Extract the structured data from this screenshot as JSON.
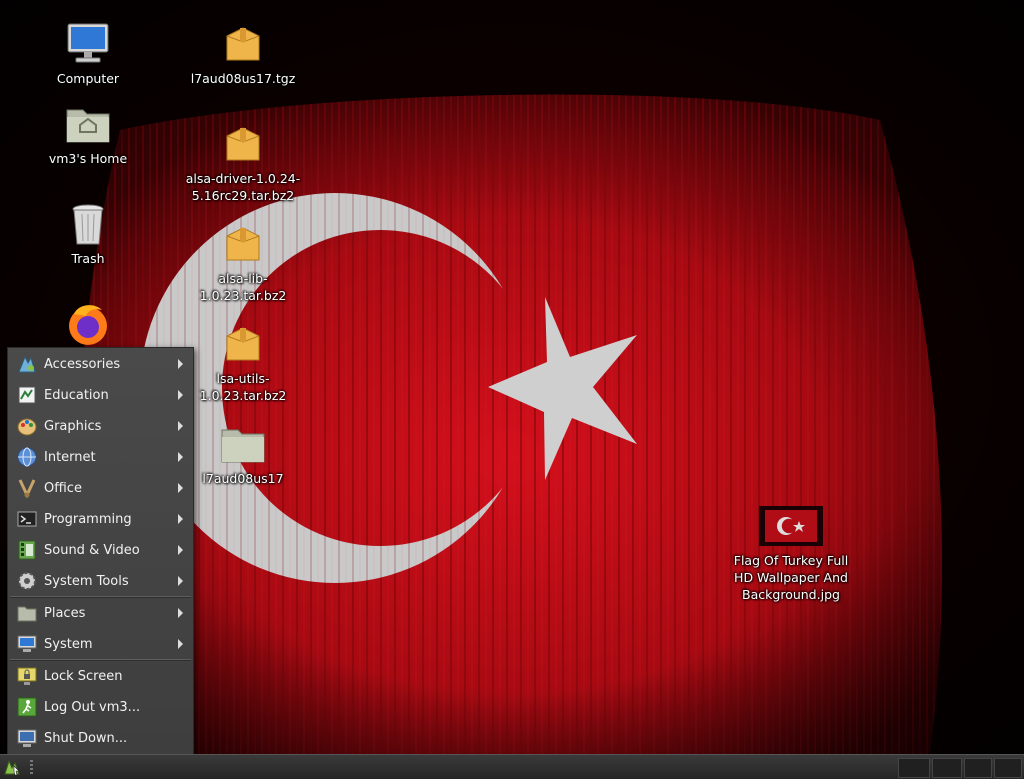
{
  "desktop": {
    "icons": [
      {
        "label": "Computer",
        "icon": "computer-icon"
      },
      {
        "label": "vm3's Home",
        "icon": "home-folder-icon"
      },
      {
        "label": "Trash",
        "icon": "trash-icon"
      },
      {
        "label": "",
        "icon": "firefox-icon"
      },
      {
        "label": "l7aud08us17.tgz",
        "icon": "archive-icon"
      },
      {
        "label": "alsa-driver-1.0.24-5.16rc29.tar.bz2",
        "icon": "archive-icon"
      },
      {
        "label": "alsa-lib-1.0.23.tar.bz2",
        "icon": "archive-icon"
      },
      {
        "label": "lsa-utils-1.0.23.tar.bz2",
        "icon": "archive-icon"
      },
      {
        "label": "l7aud08us17",
        "icon": "folder-icon"
      },
      {
        "label": "Flag Of Turkey Full HD Wallpaper And Background.jpg",
        "icon": "image-thumbnail-icon"
      }
    ]
  },
  "menu": {
    "categories": [
      {
        "label": "Accessories",
        "icon": "accessories-icon"
      },
      {
        "label": "Education",
        "icon": "education-icon"
      },
      {
        "label": "Graphics",
        "icon": "graphics-icon"
      },
      {
        "label": "Internet",
        "icon": "internet-icon"
      },
      {
        "label": "Office",
        "icon": "office-icon"
      },
      {
        "label": "Programming",
        "icon": "programming-icon"
      },
      {
        "label": "Sound & Video",
        "icon": "sound-video-icon"
      },
      {
        "label": "System Tools",
        "icon": "system-tools-icon"
      }
    ],
    "places": [
      {
        "label": "Places",
        "icon": "places-icon"
      },
      {
        "label": "System",
        "icon": "system-icon"
      }
    ],
    "actions": [
      {
        "label": "Lock Screen",
        "icon": "lock-screen-icon"
      },
      {
        "label": "Log Out vm3...",
        "icon": "log-out-icon"
      },
      {
        "label": "Shut Down...",
        "icon": "shut-down-icon"
      }
    ]
  },
  "colors": {
    "flag_red": "#c8101a",
    "menu_bg": "#444444",
    "panel_bg": "#2e2e2e"
  }
}
